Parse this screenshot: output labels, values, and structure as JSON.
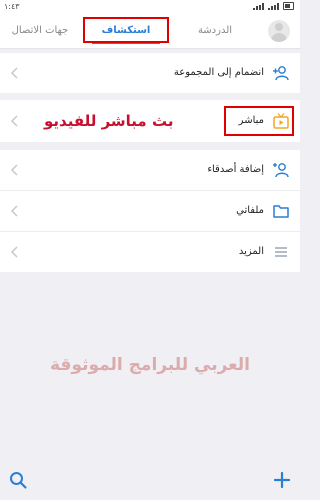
{
  "status_bar": {
    "time": "١:٤٣"
  },
  "tabs": [
    {
      "label": "جهات الاتصال"
    },
    {
      "label": "استكشاف",
      "active": true
    },
    {
      "label": "الدردشة"
    }
  ],
  "rows": {
    "join_group": "انضمام إلى المجموعة",
    "live": "مباشر",
    "add_friends": "إضافة أصدقاء",
    "my_files": "ملفاتي",
    "more": "المزيد"
  },
  "annotations": {
    "live_video": "بث مباشر للفيديو",
    "watermark": "العربي للبرامج الموثوقة"
  },
  "colors": {
    "accent": "#2a7fd4",
    "highlight": "#e00000",
    "annotation": "#c8102e",
    "live_icon": "#f5a623"
  },
  "icons": {
    "join_group": "group-add-icon",
    "live": "live-tv-icon",
    "add_friends": "person-add-icon",
    "my_files": "folder-icon",
    "more": "menu-icon",
    "search": "search-icon",
    "add": "plus-icon"
  }
}
